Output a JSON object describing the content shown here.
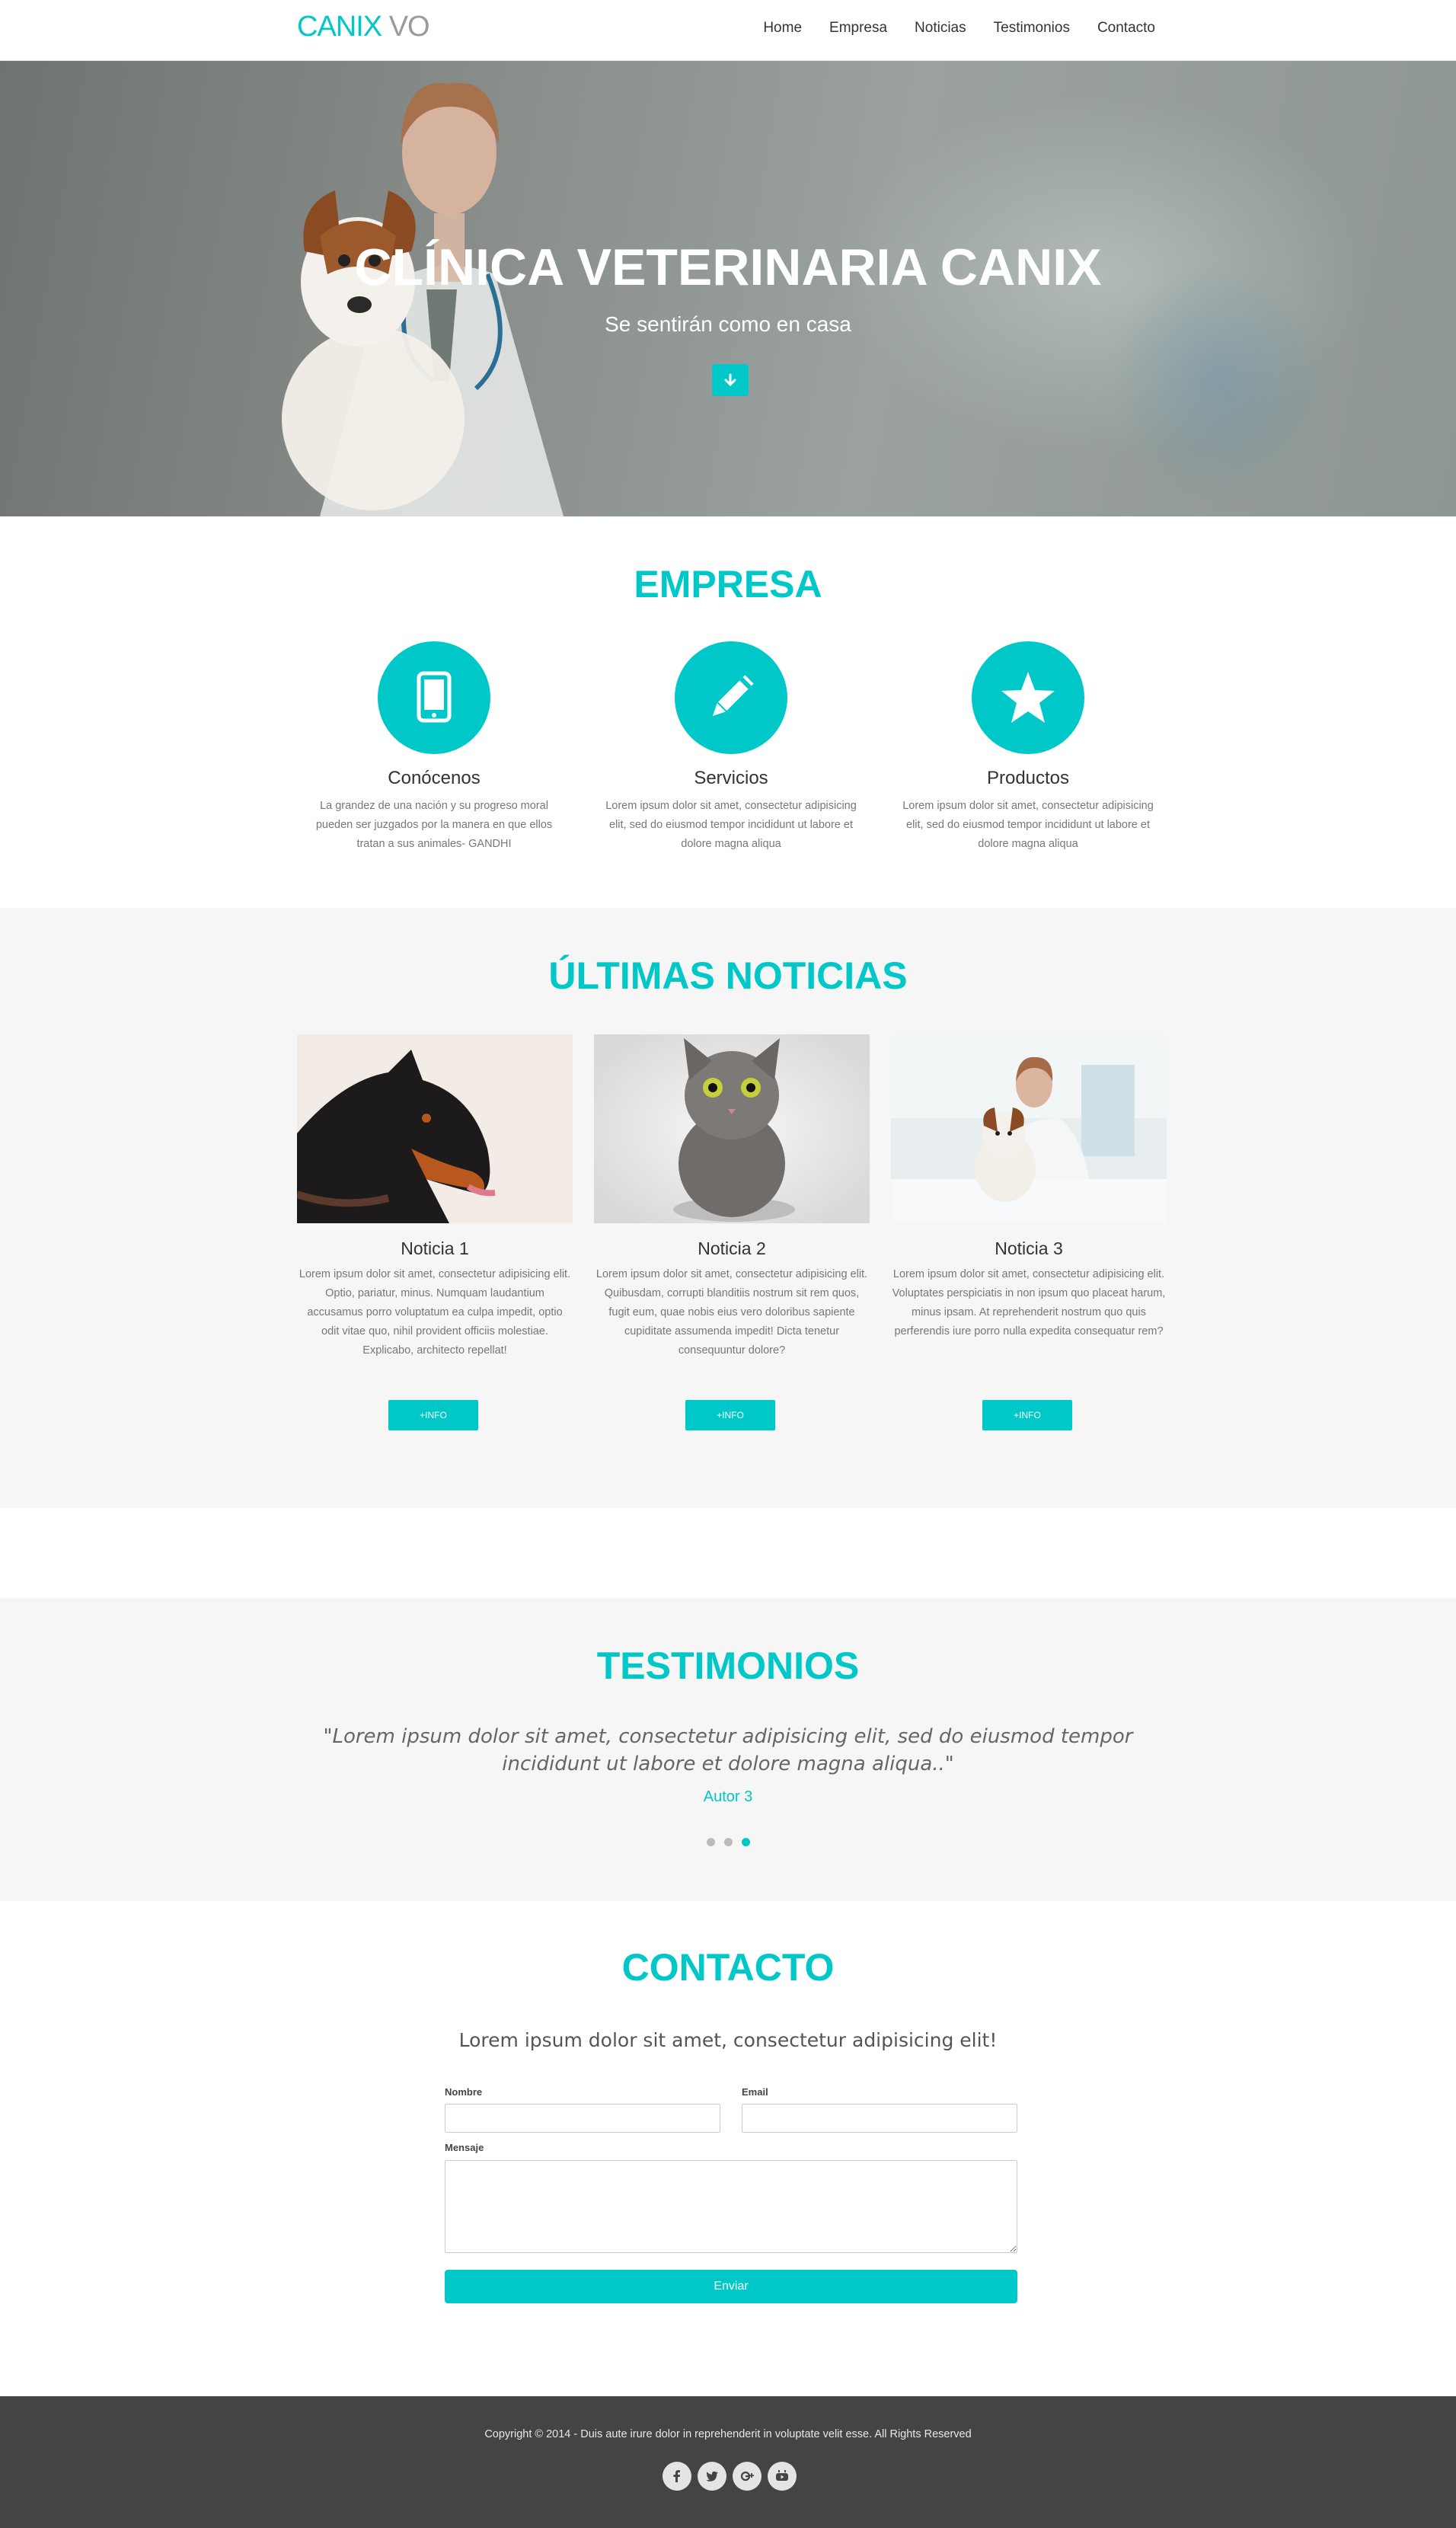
{
  "nav": {
    "brand_primary": "CANIX",
    "brand_secondary": "VO",
    "items": [
      {
        "label": "Home"
      },
      {
        "label": "Empresa"
      },
      {
        "label": "Noticias"
      },
      {
        "label": "Testimonios"
      },
      {
        "label": "Contacto"
      }
    ]
  },
  "hero": {
    "title": "CLÍNICA VETERINARIA CANIX",
    "subtitle": "Se sentirán como en casa",
    "scroll_icon": "arrow-down-icon"
  },
  "empresa": {
    "title": "EMPRESA",
    "features": [
      {
        "icon": "tablet-icon",
        "title": "Conócenos",
        "text": "La grandez de una nación y su progreso moral pueden ser juzgados por la manera en que ellos tratan a sus animales- GANDHI"
      },
      {
        "icon": "pencil-icon",
        "title": "Servicios",
        "text": "Lorem ipsum dolor sit amet, consectetur adipisicing elit, sed do eiusmod tempor incididunt ut labore et dolore magna aliqua"
      },
      {
        "icon": "star-icon",
        "title": "Productos",
        "text": "Lorem ipsum dolor sit amet, consectetur adipisicing elit, sed do eiusmod tempor incididunt ut labore et dolore magna aliqua"
      }
    ]
  },
  "noticias": {
    "title": "ÚLTIMAS NOTICIAS",
    "items": [
      {
        "title": "Noticia 1",
        "text": "Lorem ipsum dolor sit amet, consectetur adipisicing elit. Optio, pariatur, minus. Numquam laudantium accusamus porro voluptatum ea culpa impedit, optio odit vitae quo, nihil provident officiis molestiae. Explicabo, architecto repellat!",
        "button": "+INFO"
      },
      {
        "title": "Noticia 2",
        "text": "Lorem ipsum dolor sit amet, consectetur adipisicing elit. Quibusdam, corrupti blanditiis nostrum sit rem quos, fugit eum, quae nobis eius vero doloribus sapiente cupiditate assumenda impedit! Dicta tenetur consequuntur dolore?",
        "button": "+INFO"
      },
      {
        "title": "Noticia 3",
        "text": "Lorem ipsum dolor sit amet, consectetur adipisicing elit. Voluptates perspiciatis in non ipsum quo placeat harum, minus ipsam. At reprehenderit nostrum quo quis perferendis iure porro nulla expedita consequatur rem?",
        "button": "+INFO"
      }
    ]
  },
  "testimonios": {
    "title": "TESTIMONIOS",
    "quote": "\"Lorem ipsum dolor sit amet, consectetur adipisicing elit, sed do eiusmod tempor incididunt ut labore et dolore magna aliqua..\"",
    "author": "Autor 3",
    "active_slide": 3,
    "slide_count": 3
  },
  "contacto": {
    "title": "CONTACTO",
    "lead": "Lorem ipsum dolor sit amet, consectetur adipisicing elit!",
    "fields": {
      "nombre_label": "Nombre",
      "nombre_value": "",
      "email_label": "Email",
      "email_value": "",
      "mensaje_label": "Mensaje",
      "mensaje_value": ""
    },
    "submit": "Enviar"
  },
  "footer": {
    "copyright": "Copyright © 2014 - Duis aute irure dolor in reprehenderit in voluptate velit esse. All Rights Reserved",
    "socials": [
      "facebook-icon",
      "twitter-icon",
      "google-plus-icon",
      "youtube-icon"
    ]
  },
  "colors": {
    "accent": "#00c8c8",
    "footer_bg": "#444444",
    "band_bg": "#f6f6f6"
  }
}
